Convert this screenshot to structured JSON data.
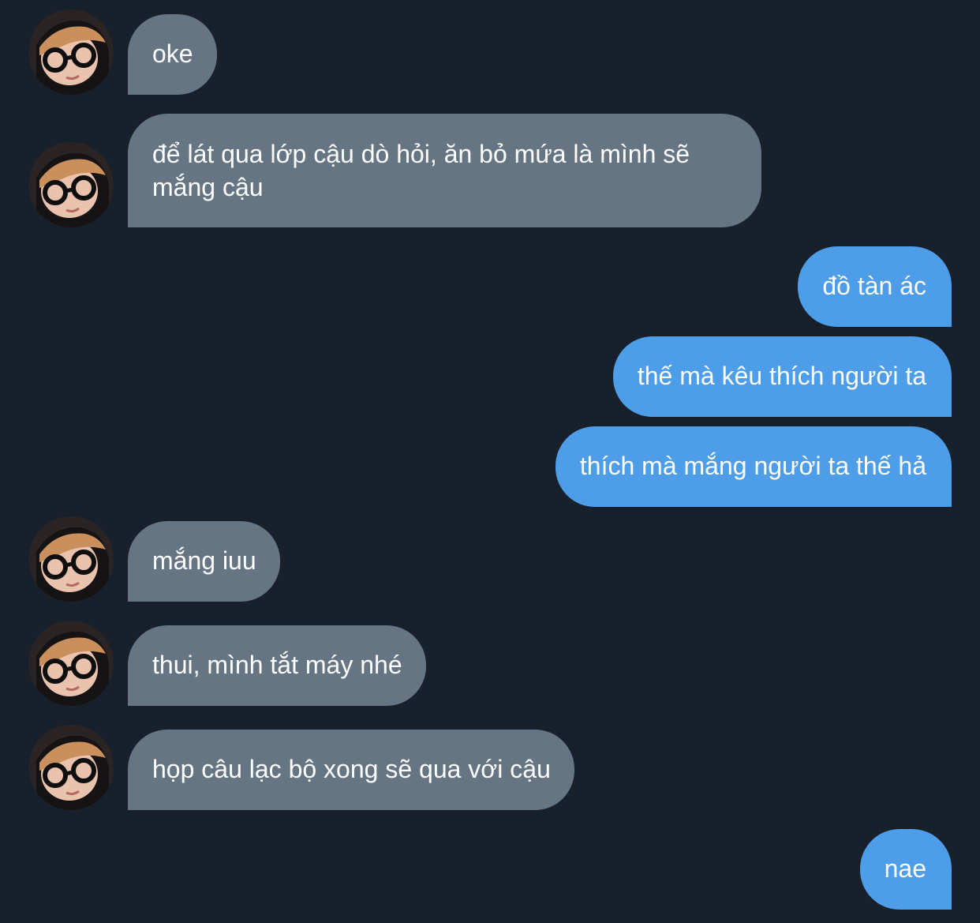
{
  "theme": {
    "background": "#18202b",
    "incoming_bubble": "#667583",
    "outgoing_bubble": "#4d9de9",
    "text": "#ffffff"
  },
  "messages": [
    {
      "direction": "incoming",
      "text": "oke",
      "avatar": "contact-avatar"
    },
    {
      "direction": "incoming",
      "text": "để lát qua lớp cậu dò hỏi, ăn bỏ mứa là mình sẽ mắng cậu",
      "avatar": "contact-avatar"
    },
    {
      "direction": "outgoing",
      "text": "đồ tàn ác"
    },
    {
      "direction": "outgoing",
      "text": "thế mà kêu thích người ta"
    },
    {
      "direction": "outgoing",
      "text": "thích mà mắng người ta thế hả"
    },
    {
      "direction": "incoming",
      "text": "mắng iuu",
      "avatar": "contact-avatar"
    },
    {
      "direction": "incoming",
      "text": "thui, mình tắt máy nhé",
      "avatar": "contact-avatar"
    },
    {
      "direction": "incoming",
      "text": "họp câu lạc bộ xong sẽ qua với cậu",
      "avatar": "contact-avatar"
    },
    {
      "direction": "outgoing",
      "text": "nae"
    }
  ]
}
